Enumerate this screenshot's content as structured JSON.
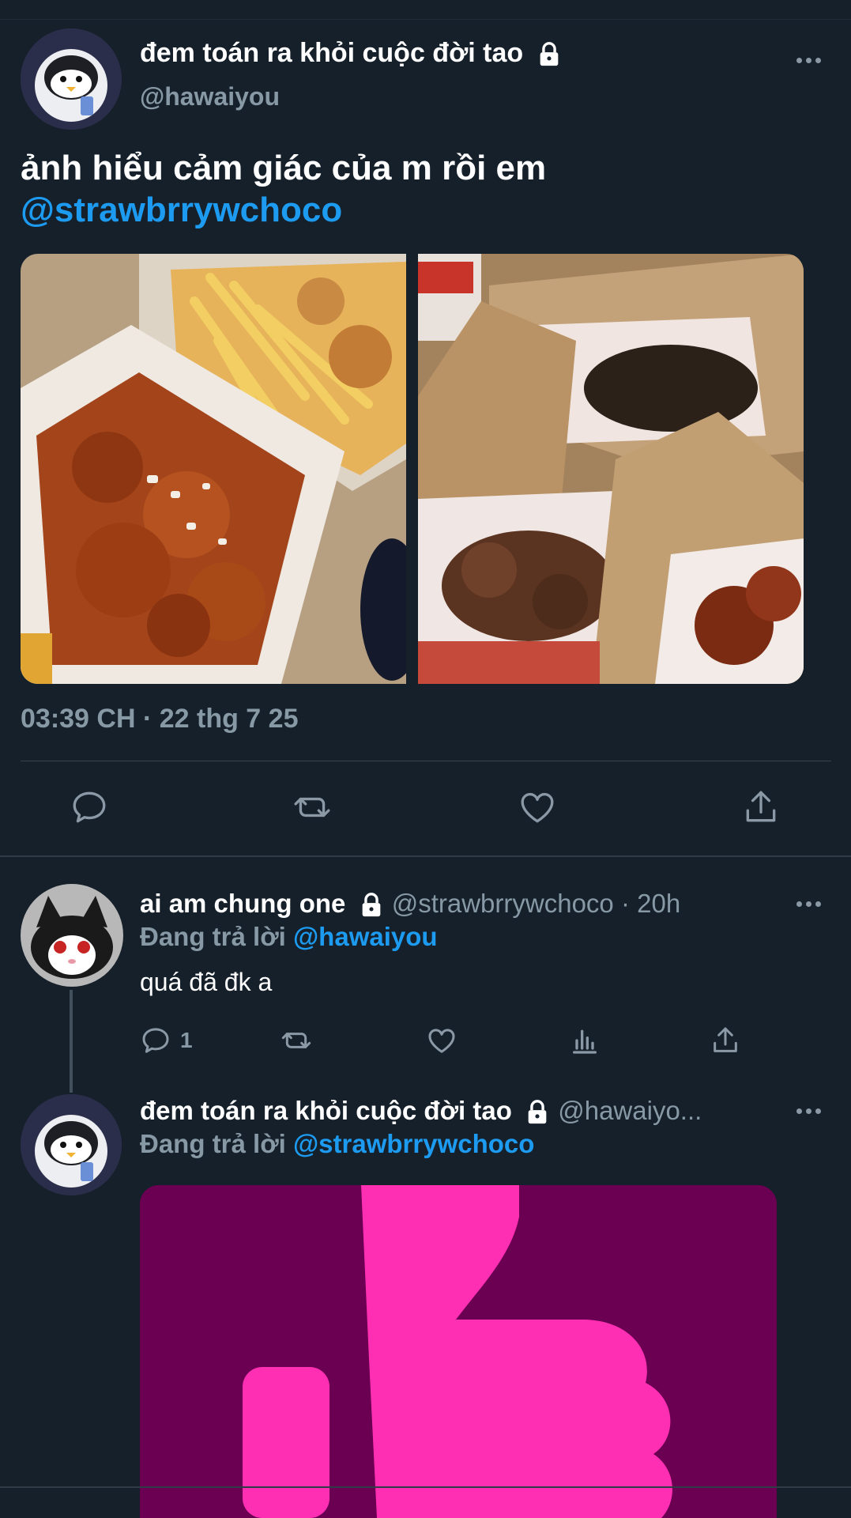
{
  "tweet": {
    "author_name": "đem toán ra khỏi cuộc đời tao",
    "author_handle": "@hawaiyou",
    "text": "ảnh hiểu cảm giác của m rồi em",
    "mention": "@strawbrrywchoco",
    "timestamp": "03:39 CH · 22 thg 7 25",
    "icons": [
      "reply-icon",
      "retweet-icon",
      "like-icon",
      "share-icon",
      "lock-icon",
      "more-icon"
    ]
  },
  "replies": [
    {
      "author_name": "ai am chung one",
      "meta": "@strawbrrywchoco · 20h",
      "replying_label": "Đang trả lời",
      "replying_to": "@hawaiyou",
      "text": "quá đã đk a",
      "reply_count": "1"
    },
    {
      "author_name": "đem toán ra khỏi cuộc đời tao",
      "meta": "@hawaiyo...",
      "replying_label": "Đang trả lời",
      "replying_to": "@strawbrrywchoco"
    }
  ],
  "colors": {
    "background": "#15202b",
    "accent": "#1d9bf0",
    "muted": "#8899a6"
  }
}
